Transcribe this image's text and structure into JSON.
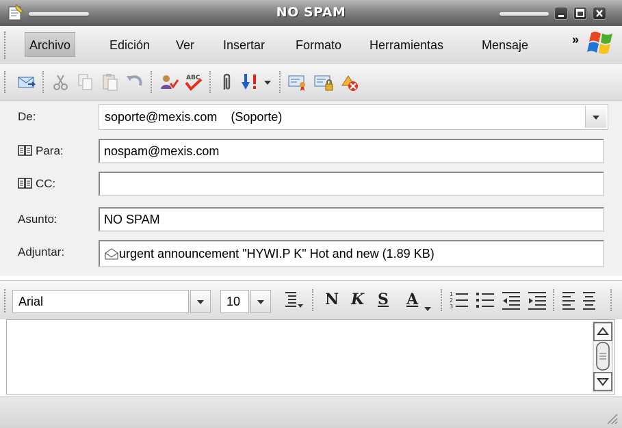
{
  "window": {
    "title": "NO SPAM"
  },
  "menu": {
    "items": [
      {
        "label": "Archivo",
        "active": true
      },
      {
        "label": "Edición"
      },
      {
        "label": "Ver"
      },
      {
        "label": "Insertar"
      },
      {
        "label": "Formato"
      },
      {
        "label": "Herramientas"
      },
      {
        "label": "Mensaje"
      }
    ],
    "overflow": "»"
  },
  "toolbar": {
    "icons": [
      "send-icon",
      "cut-icon",
      "copy-icon",
      "paste-icon",
      "undo-icon",
      "check-names-icon",
      "spelling-icon",
      "attach-icon",
      "priority-icon",
      "priority-dropdown-icon",
      "sign-icon",
      "encrypt-icon",
      "offline-icon"
    ]
  },
  "header": {
    "from_label": "De:",
    "from_value": "soporte@mexis.com    (Soporte)",
    "to_label": "Para:",
    "to_value": "nospam@mexis.com",
    "cc_label": "CC:",
    "cc_value": "",
    "subject_label": "Asunto:",
    "subject_value": "NO SPAM",
    "attach_label": "Adjuntar:",
    "attach_value": "urgent announcement \"HYWI.P K\" Hot and new (1.89 KB)"
  },
  "format": {
    "font": "Arial",
    "size": "10",
    "bold": "N",
    "italic": "K",
    "underline": "S",
    "color": "A"
  },
  "message": {
    "body": ""
  },
  "colors": {
    "titlebar": "#6e6e6e",
    "chrome": "#e4e4e4",
    "field_border": "#8a8a8a"
  }
}
